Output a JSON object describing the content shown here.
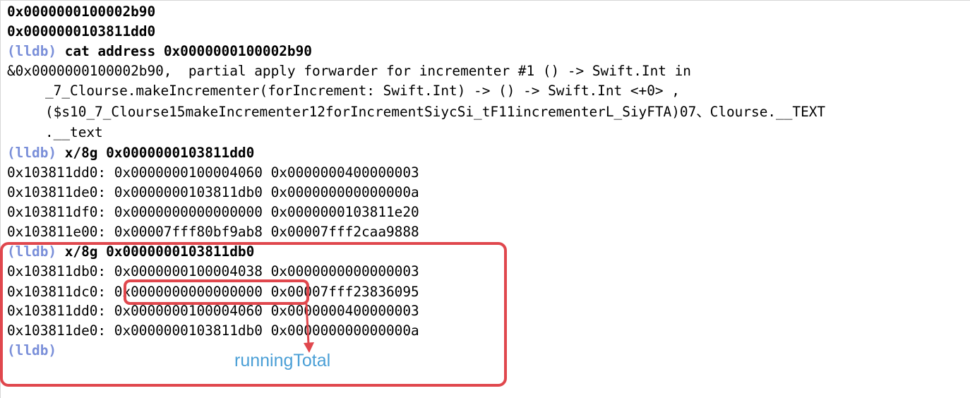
{
  "console": {
    "prompt": "(lldb)",
    "lines": [
      {
        "text": "0x0000000100002b90"
      },
      {
        "text": "0x0000000103811dd0"
      },
      {
        "cmd": "cat address 0x0000000100002b90"
      },
      {
        "text": "&0x0000000100002b90,  partial apply forwarder for incrementer #1 () -> Swift.Int in"
      },
      {
        "text": "_7_Clourse.makeIncrementer(forIncrement: Swift.Int) -> () -> Swift.Int <+0> ,"
      },
      {
        "text": "($s10_7_Clourse15makeIncrementer12forIncrementSiycSi_tF11incrementerL_SiyFTA)07、Clourse.__TEXT"
      },
      {
        "text": ".__text"
      },
      {
        "cmd": "x/8g 0x0000000103811dd0"
      },
      {
        "text": "0x103811dd0: 0x0000000100004060 0x0000000400000003"
      },
      {
        "text": "0x103811de0: 0x0000000103811db0 0x000000000000000a"
      },
      {
        "text": "0x103811df0: 0x0000000000000000 0x0000000103811e20"
      },
      {
        "text": "0x103811e00: 0x00007fff80bf9ab8 0x00007fff2caa9888"
      },
      {
        "cmd": "x/8g 0x0000000103811db0"
      },
      {
        "text": "0x103811db0: 0x0000000100004038 0x0000000000000003"
      },
      {
        "text": "0x103811dc0: 0x0000000000000000 0x00007fff23836095"
      },
      {
        "text": "0x103811dd0: 0x0000000100004060 0x0000000400000003"
      },
      {
        "text": "0x103811de0: 0x0000000103811db0 0x000000000000000a"
      },
      {
        "cmd": ""
      }
    ]
  },
  "annotation": {
    "label": "runningTotal",
    "color": "#e0474d",
    "label_color": "#4a9fd6"
  }
}
